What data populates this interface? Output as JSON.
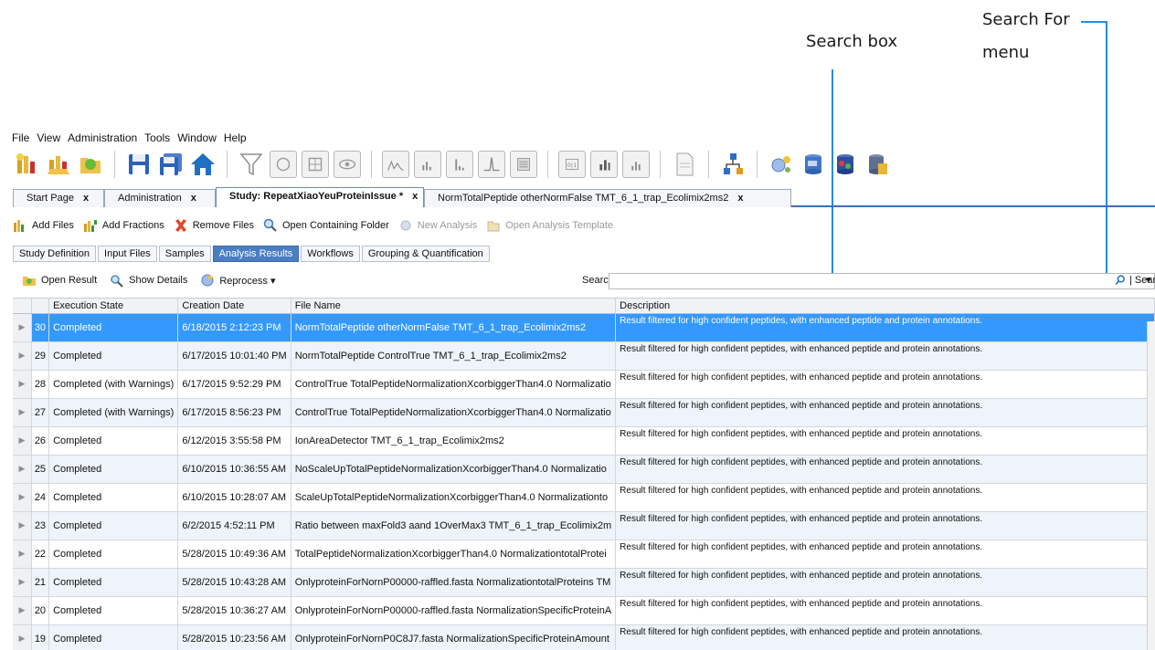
{
  "callouts": {
    "search_box": "Search box",
    "search_for_line1": "Search For",
    "search_for_line2": "menu"
  },
  "menu": [
    "File",
    "View",
    "Administration",
    "Tools",
    "Window",
    "Help"
  ],
  "toolbar_icons": [
    "new-study-icon",
    "open-study-icon",
    "open-result-icon",
    "save-icon",
    "save-all-icon",
    "home-icon",
    "filter-icon",
    "image-view-icon",
    "grid-view-icon",
    "eye-view-icon",
    "spectrum-icon",
    "chart-icon",
    "chromatogram-icon",
    "peak-icon",
    "report-icon",
    "quan-icon",
    "bar-chart-icon",
    "bar-chart-alt-icon",
    "document-icon",
    "workflow-icon",
    "job-queue-icon",
    "database-icon",
    "fasta-icon",
    "license-icon"
  ],
  "doc_tabs": [
    {
      "label": "Start Page",
      "close": "x"
    },
    {
      "label": "Administration",
      "close": "x"
    },
    {
      "label": "Study: RepeatXiaoYeuProteinIssue *",
      "close": "x"
    },
    {
      "label": "NormTotalPeptide otherNormFalse TMT_6_1_trap_Ecolimix2ms2",
      "close": "x"
    }
  ],
  "actions": {
    "add_files": "Add Files",
    "add_fractions": "Add Fractions",
    "remove_files": "Remove Files",
    "open_folder": "Open Containing Folder",
    "new_analysis": "New Analysis",
    "open_template": "Open Analysis Template"
  },
  "sub_tabs": [
    "Study Definition",
    "Input Files",
    "Samples",
    "Analysis Results",
    "Workflows",
    "Grouping & Quantification"
  ],
  "result_actions": {
    "open_result": "Open Result",
    "show_details": "Show Details",
    "reprocess": "Reprocess ▾"
  },
  "search": {
    "label": "Search:",
    "value": "",
    "search_for": "| Search for...",
    "caret": "▾"
  },
  "grid": {
    "columns": [
      "Execution State",
      "Creation Date",
      "File Name",
      "Description"
    ],
    "rows": [
      {
        "id": "30",
        "state": "Completed",
        "date": "6/18/2015 2:12:23 PM",
        "file": "NormTotalPeptide otherNormFalse TMT_6_1_trap_Ecolimix2ms2",
        "desc": "Result filtered for high confident peptides, with enhanced peptide and protein annotations."
      },
      {
        "id": "29",
        "state": "Completed",
        "date": "6/17/2015 10:01:40 PM",
        "file": "NormTotalPeptide ControlTrue TMT_6_1_trap_Ecolimix2ms2",
        "desc": "Result filtered for high confident peptides, with enhanced peptide and protein annotations."
      },
      {
        "id": "28",
        "state": "Completed (with Warnings)",
        "date": "6/17/2015 9:52:29 PM",
        "file": "ControlTrue TotalPeptideNormalizationXcorbiggerThan4.0 Normalizatio",
        "desc": "Result filtered for high confident peptides, with enhanced peptide and protein annotations."
      },
      {
        "id": "27",
        "state": "Completed (with Warnings)",
        "date": "6/17/2015 8:56:23 PM",
        "file": "ControlTrue TotalPeptideNormalizationXcorbiggerThan4.0 Normalizatio",
        "desc": "Result filtered for high confident peptides, with enhanced peptide and protein annotations."
      },
      {
        "id": "26",
        "state": "Completed",
        "date": "6/12/2015 3:55:58 PM",
        "file": "IonAreaDetector  TMT_6_1_trap_Ecolimix2ms2",
        "desc": "Result filtered for high confident peptides, with enhanced peptide and protein annotations."
      },
      {
        "id": "25",
        "state": "Completed",
        "date": "6/10/2015 10:36:55 AM",
        "file": "NoScaleUpTotalPeptideNormalizationXcorbiggerThan4.0 Normalizatio",
        "desc": "Result filtered for high confident peptides, with enhanced peptide and protein annotations."
      },
      {
        "id": "24",
        "state": "Completed",
        "date": "6/10/2015 10:28:07 AM",
        "file": "ScaleUpTotalPeptideNormalizationXcorbiggerThan4.0 Normalizationto",
        "desc": "Result filtered for high confident peptides, with enhanced peptide and protein annotations."
      },
      {
        "id": "23",
        "state": "Completed",
        "date": "6/2/2015 4:52:11 PM",
        "file": "Ratio between maxFold3 aand 1OverMax3 TMT_6_1_trap_Ecolimix2m",
        "desc": "Result filtered for high confident peptides, with enhanced peptide and protein annotations."
      },
      {
        "id": "22",
        "state": "Completed",
        "date": "5/28/2015 10:49:36 AM",
        "file": "TotalPeptideNormalizationXcorbiggerThan4.0 NormalizationtotalProtei",
        "desc": "Result filtered for high confident peptides, with enhanced peptide and protein annotations."
      },
      {
        "id": "21",
        "state": "Completed",
        "date": "5/28/2015 10:43:28 AM",
        "file": "OnlyproteinForNornP00000-raffled.fasta NormalizationtotalProteins TM",
        "desc": "Result filtered for high confident peptides, with enhanced peptide and protein annotations."
      },
      {
        "id": "20",
        "state": "Completed",
        "date": "5/28/2015 10:36:27 AM",
        "file": "OnlyproteinForNornP00000-raffled.fasta NormalizationSpecificProteinA",
        "desc": "Result filtered for high confident peptides, with enhanced peptide and protein annotations."
      },
      {
        "id": "19",
        "state": "Completed",
        "date": "5/28/2015 10:23:56 AM",
        "file": "OnlyproteinForNornP0C8J7.fasta NormalizationSpecificProteinAmount",
        "desc": "Result filtered for high confident peptides, with enhanced peptide and protein annotations."
      }
    ]
  },
  "colors": {
    "callout_line": "#1f8fe0",
    "selected_row": "#3399ff",
    "active_tab": "#4a7ec2",
    "alt_row": "#eef4f9"
  }
}
